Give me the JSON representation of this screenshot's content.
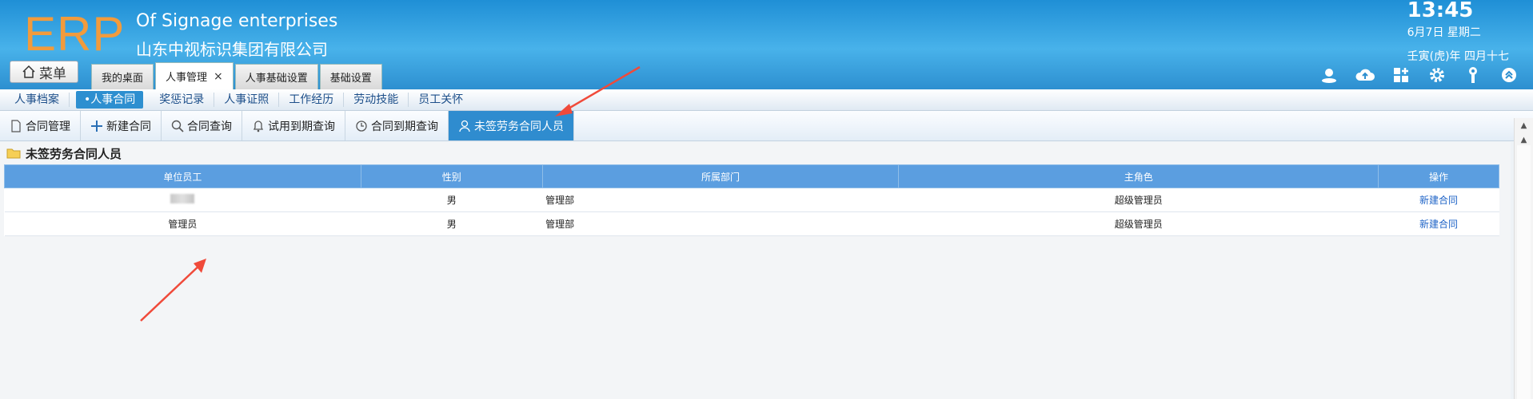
{
  "header": {
    "logo": "ERP",
    "brand_en": "Of Signage enterprises",
    "brand_cn": "山东中视标识集团有限公司",
    "time": "13:45",
    "date": "6月7日 星期二",
    "lunar": "壬寅(虎)年 四月十七",
    "menu_label": "菜单",
    "logo_color": "#f29b3c"
  },
  "tabs": [
    {
      "label": "我的桌面"
    },
    {
      "label": "人事管理",
      "close": "×"
    },
    {
      "label": "人事基础设置"
    },
    {
      "label": "基础设置"
    }
  ],
  "tools": [
    "user-cloud-icon",
    "cloud-upload-icon",
    "apps-icon",
    "gear-icon",
    "key-icon",
    "collapse-icon"
  ],
  "subnav": [
    "人事档案",
    "•人事合同",
    "奖惩记录",
    "人事证照",
    "工作经历",
    "劳动技能",
    "员工关怀"
  ],
  "toolbar": [
    "合同管理",
    "新建合同",
    "合同查询",
    "试用到期查询",
    "合同到期查询",
    "未签劳务合同人员"
  ],
  "panel": {
    "title": "未签劳务合同人员",
    "columns": [
      "单位员工",
      "性别",
      "所属部门",
      "主角色",
      "操作"
    ],
    "rows": [
      {
        "name": "",
        "gender": "男",
        "dept": "管理部",
        "role": "超级管理员",
        "action": "新建合同"
      },
      {
        "name": "管理员",
        "gender": "男",
        "dept": "管理部",
        "role": "超级管理员",
        "action": "新建合同"
      }
    ]
  }
}
